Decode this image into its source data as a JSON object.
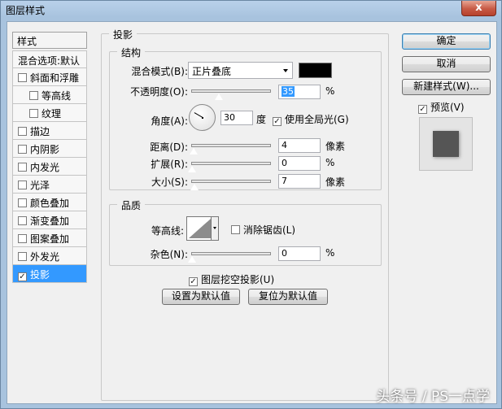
{
  "window": {
    "title": "图层样式",
    "close_label": "x"
  },
  "styles": {
    "header": "样式",
    "items": [
      {
        "label": "混合选项:默认",
        "checkbox": false,
        "checked": false
      },
      {
        "label": "斜面和浮雕",
        "checkbox": true,
        "checked": false
      },
      {
        "label": "等高线",
        "checkbox": true,
        "checked": false
      },
      {
        "label": "纹理",
        "checkbox": true,
        "checked": false
      },
      {
        "label": "描边",
        "checkbox": true,
        "checked": false
      },
      {
        "label": "内阴影",
        "checkbox": true,
        "checked": false
      },
      {
        "label": "内发光",
        "checkbox": true,
        "checked": false
      },
      {
        "label": "光泽",
        "checkbox": true,
        "checked": false
      },
      {
        "label": "颜色叠加",
        "checkbox": true,
        "checked": false
      },
      {
        "label": "渐变叠加",
        "checkbox": true,
        "checked": false
      },
      {
        "label": "图案叠加",
        "checkbox": true,
        "checked": false
      },
      {
        "label": "外发光",
        "checkbox": true,
        "checked": false
      },
      {
        "label": "投影",
        "checkbox": true,
        "checked": true,
        "selected": true
      }
    ]
  },
  "drop_shadow": {
    "title": "投影",
    "structure": {
      "title": "结构",
      "blend_mode_label": "混合模式(B):",
      "blend_mode_value": "正片叠底",
      "shadow_color": "#000000",
      "opacity_label": "不透明度(O):",
      "opacity_value": "35",
      "opacity_unit": "%",
      "angle_label": "角度(A):",
      "angle_value": "30",
      "angle_unit": "度",
      "global_light_label": "使用全局光(G)",
      "global_light_checked": true,
      "distance_label": "距离(D):",
      "distance_value": "4",
      "distance_unit": "像素",
      "spread_label": "扩展(R):",
      "spread_value": "0",
      "spread_unit": "%",
      "size_label": "大小(S):",
      "size_value": "7",
      "size_unit": "像素"
    },
    "quality": {
      "title": "品质",
      "contour_label": "等高线:",
      "antialias_label": "消除锯齿(L)",
      "antialias_checked": false,
      "noise_label": "杂色(N):",
      "noise_value": "0",
      "noise_unit": "%"
    },
    "knockout_label": "图层挖空投影(U)",
    "knockout_checked": true,
    "make_default_label": "设置为默认值",
    "reset_default_label": "复位为默认值"
  },
  "buttons": {
    "ok": "确定",
    "cancel": "取消",
    "new_style": "新建样式(W)...",
    "preview_label": "预览(V)",
    "preview_checked": true
  },
  "watermark": "头条号 / PS一点学"
}
